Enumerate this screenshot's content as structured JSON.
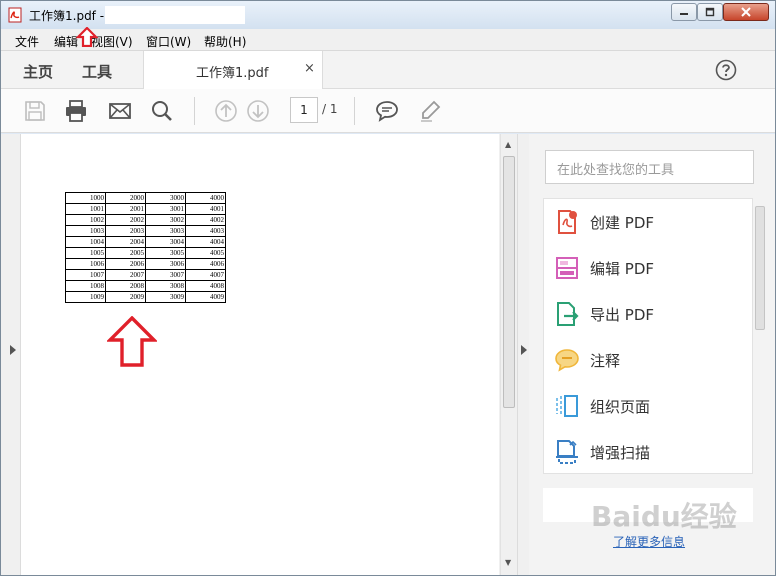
{
  "window": {
    "title": "工作簿1.pdf -",
    "controls": {
      "minimize": "minimize-icon",
      "maximize": "maximize-icon",
      "close": "close-icon"
    }
  },
  "menubar": {
    "items": [
      {
        "label": "文件"
      },
      {
        "label": "编辑"
      },
      {
        "label": "视图(V)"
      },
      {
        "label": "窗口(W)"
      },
      {
        "label": "帮助(H)"
      }
    ]
  },
  "tabs": {
    "home": "主页",
    "tools": "工具",
    "document": "工作簿1.pdf",
    "close_glyph": "×",
    "help_icon": "help-circle-icon"
  },
  "toolbar": {
    "icons": [
      "save-icon",
      "print-icon",
      "email-icon",
      "search-icon",
      "page-up-icon",
      "page-down-icon",
      "comment-icon",
      "highlight-pen-icon"
    ],
    "page_current": "1",
    "page_total": "/ 1"
  },
  "document": {
    "table": [
      [
        "1000",
        "2000",
        "3000",
        "4000"
      ],
      [
        "1001",
        "2001",
        "3001",
        "4001"
      ],
      [
        "1002",
        "2002",
        "3002",
        "4002"
      ],
      [
        "1003",
        "2003",
        "3003",
        "4003"
      ],
      [
        "1004",
        "2004",
        "3004",
        "4004"
      ],
      [
        "1005",
        "2005",
        "3005",
        "4005"
      ],
      [
        "1006",
        "2006",
        "3006",
        "4006"
      ],
      [
        "1007",
        "2007",
        "3007",
        "4007"
      ],
      [
        "1008",
        "2008",
        "3008",
        "4008"
      ],
      [
        "1009",
        "2009",
        "3009",
        "4009"
      ]
    ]
  },
  "right_pane": {
    "search_placeholder": "在此处查找您的工具",
    "tools": [
      {
        "label": "创建 PDF",
        "icon": "create-pdf-icon",
        "color": "#e0513f"
      },
      {
        "label": "编辑 PDF",
        "icon": "edit-pdf-icon",
        "color": "#d45fb8"
      },
      {
        "label": "导出 PDF",
        "icon": "export-pdf-icon",
        "color": "#2aa074"
      },
      {
        "label": "注释",
        "icon": "comment-tool-icon",
        "color": "#f0b63a"
      },
      {
        "label": "组织页面",
        "icon": "organize-pages-icon",
        "color": "#3a9ad9"
      },
      {
        "label": "增强扫描",
        "icon": "enhance-scan-icon",
        "color": "#3a7fc4"
      }
    ],
    "more_info": "了解更多信息"
  },
  "watermark": "Baidu经验",
  "colors": {
    "annotation_arrow": "#e0202a",
    "link": "#2a63b8"
  }
}
